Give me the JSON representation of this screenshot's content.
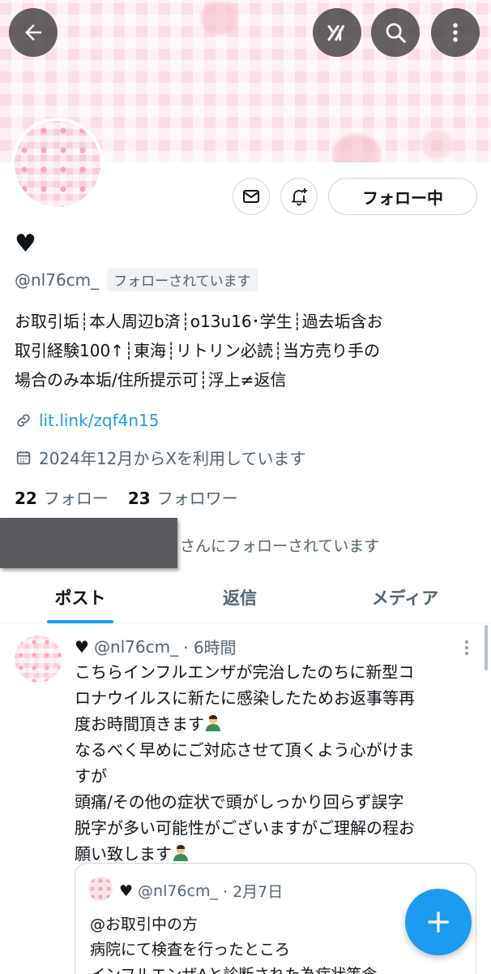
{
  "profile": {
    "name": "♥",
    "handle": "@nl76cm_",
    "follows_you_badge": "フォローされています",
    "bio_lines": [
      "お取引垢┊本人周辺b済┊o13u16･学生┊過去垢含お",
      "取引経験100↑┊東海┊リトリン必読┊当方売り手の",
      "場合のみ本垢/住所提示可┊浮上≠返信"
    ],
    "link": "lit.link/zqf4n15",
    "joined": "2024年12月からXを利用しています",
    "following_count": "22",
    "following_label": "フォロー",
    "followers_count": "23",
    "followers_label": "フォロワー",
    "followed_by_text": "さんにフォローされています"
  },
  "actions": {
    "follow_button_label": "フォロー中",
    "message_icon": "envelope-icon",
    "notify_icon": "bell-plus-icon"
  },
  "header": {
    "back_icon": "arrow-left-icon",
    "grok_icon": "grok-icon",
    "search_icon": "search-icon",
    "more_icon": "more-vertical-icon"
  },
  "tabs": [
    {
      "label": "ポスト",
      "active": true
    },
    {
      "label": "返信",
      "active": false
    },
    {
      "label": "メディア",
      "active": false
    }
  ],
  "post": {
    "name": "♥",
    "handle": "@nl76cm_",
    "time": "· 6時間",
    "lines": [
      "こちらインフルエンザが完治したのちに新型コ",
      "ロナウイルスに新たに感染したためお返事等再",
      "度お時間頂きます",
      "なるべく早めにご対応させて頂くよう心がけま",
      "すが",
      "頭痛/その他の症状で頭がしっかり回らず誤字",
      "脱字が多い可能性がございますがご理解の程お",
      "願い致します"
    ]
  },
  "quote": {
    "name": "♥",
    "handle": "@nl76cm_",
    "time": "· 2月7日",
    "lines": [
      "@お取引中の方",
      "病院にて検査を行ったところ",
      "インフルエンザAと診断された為症状等含"
    ]
  },
  "colors": {
    "accent": "#1d9bf0",
    "text_primary": "#0f1419",
    "text_secondary": "#536471"
  }
}
